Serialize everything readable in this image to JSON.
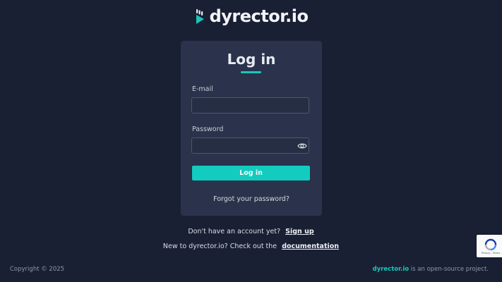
{
  "brand": {
    "name": "dyrector.io",
    "accent": "#16c6ba"
  },
  "login_card": {
    "title": "Log in",
    "email_label": "E-mail",
    "email_value": "",
    "password_label": "Password",
    "password_value": "",
    "submit_label": "Log in",
    "forgot_link": "Forgot your password?"
  },
  "signup_prompt": {
    "text": "Don't have an account yet?",
    "link": "Sign up"
  },
  "docs_prompt": {
    "text": "New to dyrector.io? Check out the",
    "link": "documentation"
  },
  "footer": {
    "copyright": "Copyright © 2025",
    "brand": "dyrector.io",
    "tagline": " is an open-source project."
  },
  "recaptcha": {
    "terms": "Privacy - Terms"
  },
  "colors": {
    "background": "#1a2034",
    "card": "#2a334b",
    "button": "#12ccbf"
  },
  "icons": [
    "dyrector-logo-icon",
    "eye-icon",
    "recaptcha-icon"
  ]
}
